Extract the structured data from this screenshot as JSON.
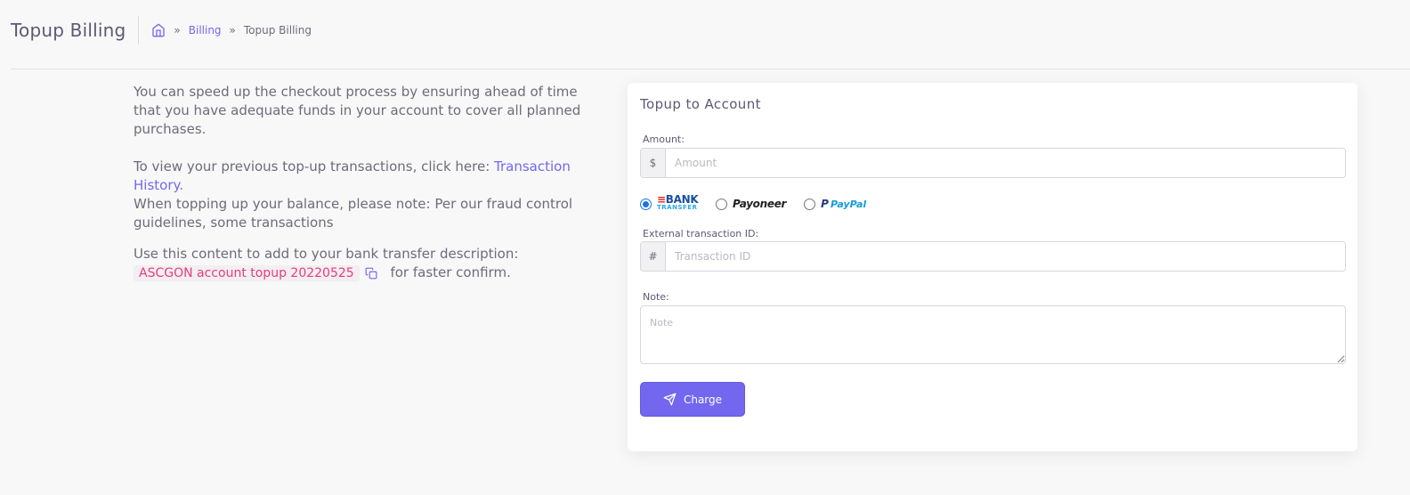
{
  "header": {
    "title": "Topup Billing",
    "breadcrumb": {
      "home_icon": "home-icon",
      "separator": "»",
      "items": [
        {
          "label": "Billing"
        },
        {
          "label": "Topup Billing"
        }
      ]
    }
  },
  "info": {
    "intro": "You can speed up the checkout process by ensuring ahead of time that you have adequate funds in your account to cover all planned purchases.",
    "history_prefix": "To view your previous top-up transactions, click here: ",
    "history_link": "Transaction History.",
    "fraud_note": "When topping up your balance, please note: Per our fraud control guidelines, some transactions",
    "description_prefix": "Use this content to add to your bank transfer description:",
    "description_code": "ASCGON account topup 20220525",
    "copy_icon": "copy-icon",
    "description_suffix": "for faster confirm."
  },
  "form": {
    "title": "Topup to Account",
    "amount": {
      "label": "Amount:",
      "addon": "$",
      "placeholder": "Amount",
      "value": ""
    },
    "payment_methods": [
      {
        "name": "bank-transfer",
        "selected": true,
        "logo_text": [
          "BANK",
          "TRANSFER"
        ]
      },
      {
        "name": "payoneer",
        "selected": false,
        "logo_text": "Payoneer"
      },
      {
        "name": "paypal",
        "selected": false,
        "logo_text": "PayPal"
      }
    ],
    "transaction_id": {
      "label": "External transaction ID:",
      "addon": "#",
      "placeholder": "Transaction ID",
      "value": ""
    },
    "note": {
      "label": "Note:",
      "placeholder": "Note",
      "value": ""
    },
    "submit_label": "Charge",
    "submit_icon": "send-icon"
  },
  "colors": {
    "accent": "#7367f0",
    "code_text": "#e73d7d",
    "code_bg": "#f3eef1",
    "background": "#f8f8f8"
  }
}
